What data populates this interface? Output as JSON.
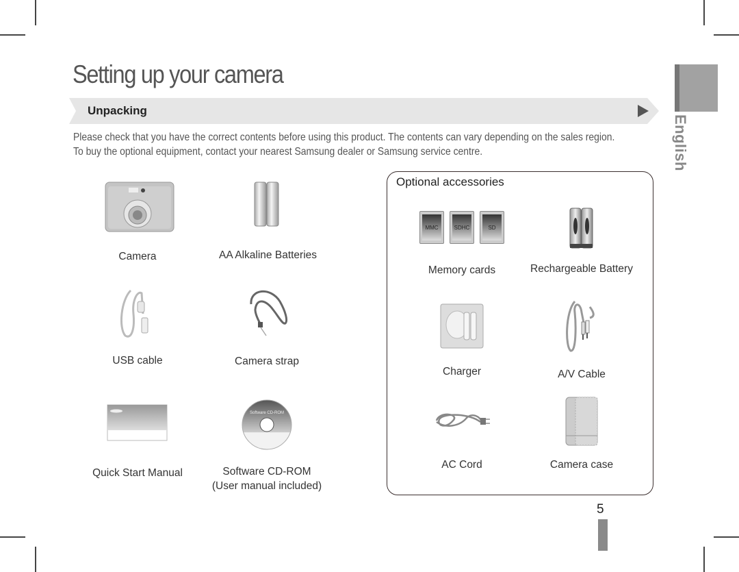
{
  "page": {
    "title": "Setting up your camera",
    "section": "Unpacking",
    "intro_line1": "Please check that you have the correct contents before using this product. The contents can vary depending on the sales region.",
    "intro_line2": "To buy the optional equipment, contact your nearest Samsung dealer or Samsung service centre.",
    "language_tab": "English",
    "page_number": "5"
  },
  "included": [
    {
      "label": "Camera",
      "icon": "camera-icon"
    },
    {
      "label": "AA Alkaline Batteries",
      "icon": "batteries-icon"
    },
    {
      "label": "USB cable",
      "icon": "usb-cable-icon"
    },
    {
      "label": "Camera strap",
      "icon": "camera-strap-icon"
    },
    {
      "label": "Quick Start Manual",
      "icon": "manual-icon"
    },
    {
      "label": "Software CD-ROM",
      "sublabel": "(User manual included)",
      "icon": "cd-rom-icon",
      "disc_text": "Software CD-ROM"
    }
  ],
  "optional": {
    "title": "Optional accessories",
    "items": [
      {
        "label": "Memory cards",
        "icon": "memory-cards-icon",
        "cards": [
          "MMC",
          "SDHC",
          "SD"
        ]
      },
      {
        "label": "Rechargeable Battery",
        "icon": "rechargeable-battery-icon"
      },
      {
        "label": "Charger",
        "icon": "charger-icon"
      },
      {
        "label": "A/V Cable",
        "icon": "av-cable-icon"
      },
      {
        "label": "AC Cord",
        "icon": "ac-cord-icon"
      },
      {
        "label": "Camera case",
        "icon": "camera-case-icon"
      }
    ]
  },
  "colors": {
    "title": "#555555",
    "section_bar": "#e6e6e6",
    "tab_block": "#a2a2a2",
    "box_border": "#3a2e2e"
  }
}
